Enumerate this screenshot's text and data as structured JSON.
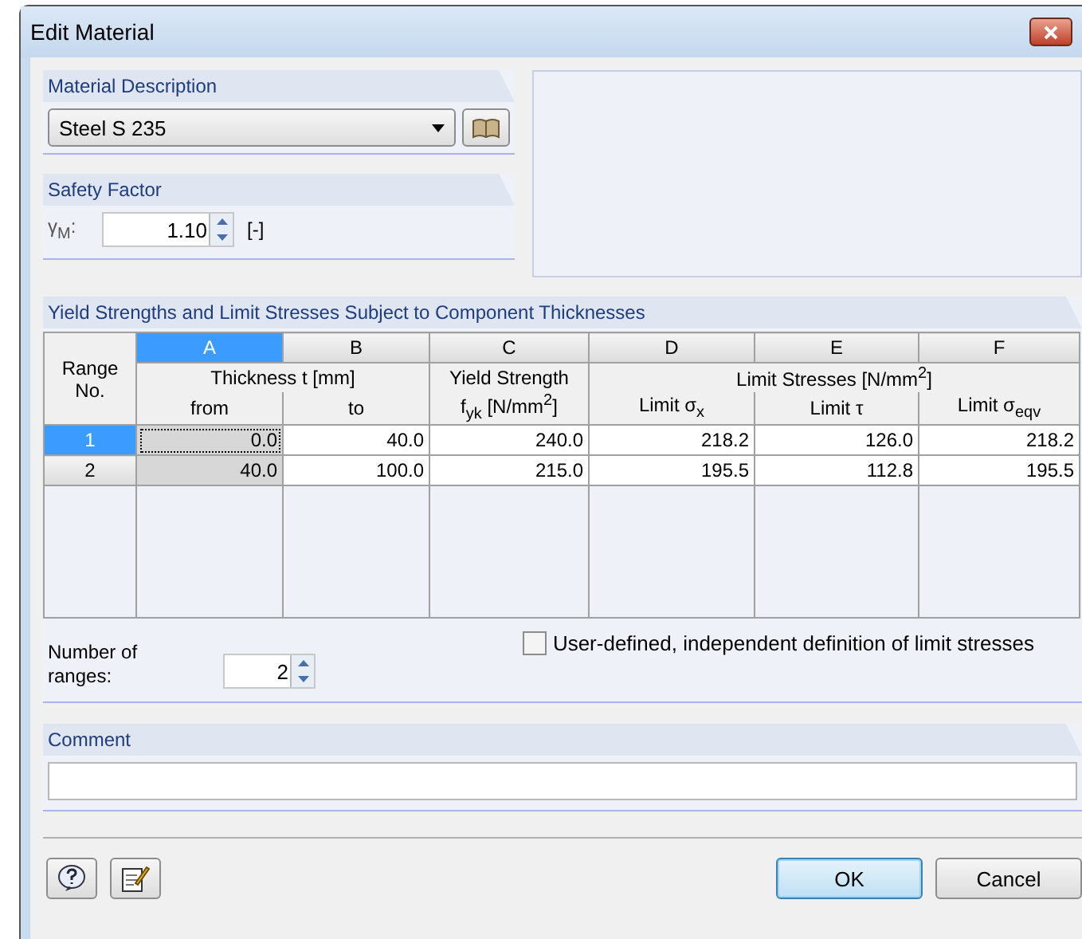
{
  "window": {
    "title": "Edit Material"
  },
  "material_description": {
    "title": "Material Description",
    "value": "Steel S 235"
  },
  "safety_factor": {
    "title": "Safety Factor",
    "label": "γ$_{M}$:",
    "value": "1.10",
    "unit": "[-]"
  },
  "table": {
    "title": "Yield Strengths and Limit Stresses Subject to Component Thicknesses",
    "row_header": "Range No.",
    "columns": [
      {
        "letter": "A",
        "selected": true,
        "sub": "from"
      },
      {
        "letter": "B",
        "selected": false,
        "sub": "to"
      },
      {
        "letter": "C",
        "selected": false,
        "sub": "f$_{yk}$ [N/mm$^{2}$]"
      },
      {
        "letter": "D",
        "selected": false,
        "sub": "Limit σ$_{x}$"
      },
      {
        "letter": "E",
        "selected": false,
        "sub": "Limit τ"
      },
      {
        "letter": "F",
        "selected": false,
        "sub": "Limit σ$_{eqv}$"
      }
    ],
    "groups": [
      {
        "label": "Thickness t [mm]"
      },
      {
        "label": "Yield Strength"
      },
      {
        "label": "Limit Stresses [N/mm$^{2}$]"
      }
    ],
    "rows": [
      {
        "number": "1",
        "selected": true,
        "cells": [
          {
            "value": "0.0",
            "focused": true
          },
          {
            "value": "40.0",
            "focused": false
          },
          {
            "value": "240.0",
            "focused": false
          },
          {
            "value": "218.2",
            "focused": false
          },
          {
            "value": "126.0",
            "focused": false
          },
          {
            "value": "218.2",
            "focused": false
          }
        ]
      },
      {
        "number": "2",
        "selected": false,
        "cells": [
          {
            "value": "40.0",
            "focused": false
          },
          {
            "value": "100.0",
            "focused": false
          },
          {
            "value": "215.0",
            "focused": false
          },
          {
            "value": "195.5",
            "focused": false
          },
          {
            "value": "112.8",
            "focused": false
          },
          {
            "value": "195.5",
            "focused": false
          }
        ]
      }
    ],
    "ranges_label": "Number of ranges:",
    "ranges_value": "2",
    "user_defined": {
      "label": "User-defined, independent definition of limit stresses",
      "checked": false
    }
  },
  "comment": {
    "title": "Comment"
  },
  "buttons": [
    {
      "label": "OK",
      "default": true
    },
    {
      "label": "Cancel",
      "default": false
    }
  ]
}
